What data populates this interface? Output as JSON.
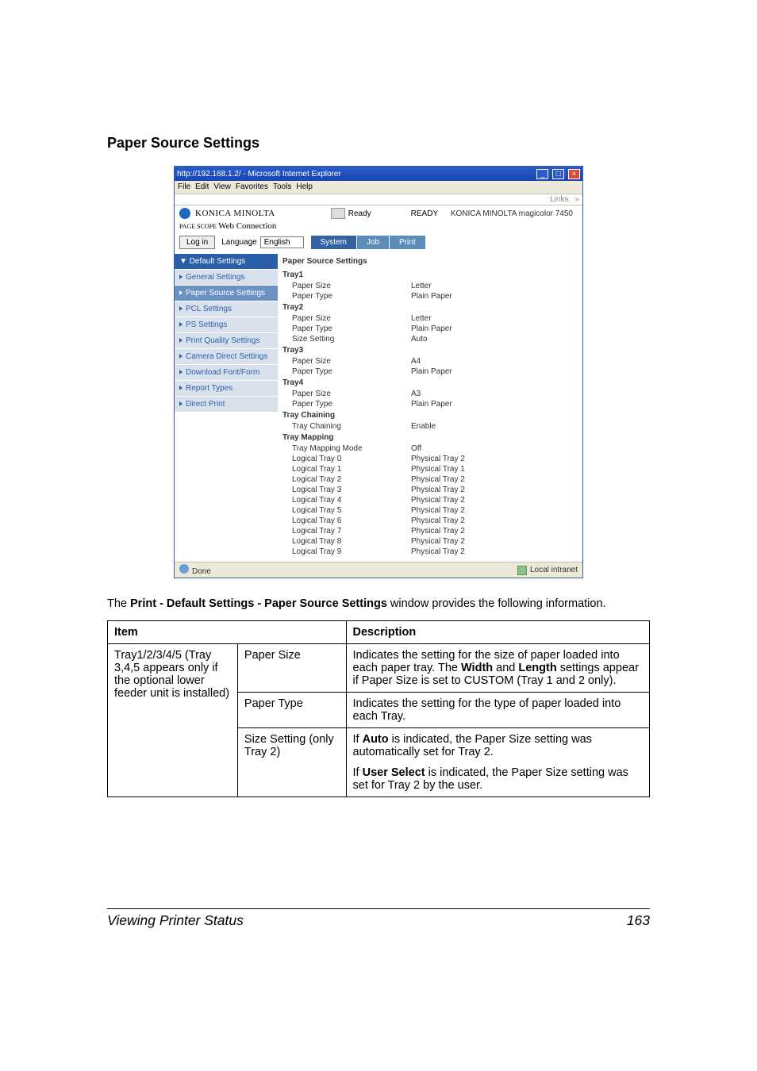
{
  "section_title": "Paper Source Settings",
  "shot": {
    "title_bar": "http://192.168.1.2/ - Microsoft Internet Explorer",
    "menus": [
      "File",
      "Edit",
      "View",
      "Favorites",
      "Tools",
      "Help"
    ],
    "links_label": "Links",
    "brand": "KONICA MINOLTA",
    "status_label": "Ready",
    "status_main": "READY",
    "model": "KONICA MINOLTA magicolor 7450",
    "psws": "Web Connection",
    "psws_sup": "PAGE SCOPE",
    "login": "Log in",
    "lang_label": "Language",
    "lang_value": "English",
    "tabs": {
      "system": "System",
      "job": "Job",
      "print": "Print"
    },
    "side_header": "Default Settings",
    "side_items": [
      "General Settings",
      "Paper Source Settings",
      "PCL Settings",
      "PS Settings",
      "Print Quality Settings",
      "Camera Direct Settings",
      "Download Font/Form",
      "Report Types",
      "Direct Print"
    ],
    "content_heading": "Paper Source Settings",
    "trays": [
      {
        "name": "Tray1",
        "rows": [
          [
            "Paper Size",
            "Letter"
          ],
          [
            "Paper Type",
            "Plain Paper"
          ]
        ]
      },
      {
        "name": "Tray2",
        "rows": [
          [
            "Paper Size",
            "Letter"
          ],
          [
            "Paper Type",
            "Plain Paper"
          ],
          [
            "Size Setting",
            "Auto"
          ]
        ]
      },
      {
        "name": "Tray3",
        "rows": [
          [
            "Paper Size",
            "A4"
          ],
          [
            "Paper Type",
            "Plain Paper"
          ]
        ]
      },
      {
        "name": "Tray4",
        "rows": [
          [
            "Paper Size",
            "A3"
          ],
          [
            "Paper Type",
            "Plain Paper"
          ]
        ]
      }
    ],
    "chain_hdr": "Tray Chaining",
    "chain_rows": [
      [
        "Tray Chaining",
        "Enable"
      ]
    ],
    "map_hdr": "Tray Mapping",
    "map_rows": [
      [
        "Tray Mapping Mode",
        "Off"
      ],
      [
        "Logical Tray 0",
        "Physical Tray 2"
      ],
      [
        "Logical Tray 1",
        "Physical Tray 1"
      ],
      [
        "Logical Tray 2",
        "Physical Tray 2"
      ],
      [
        "Logical Tray 3",
        "Physical Tray 2"
      ],
      [
        "Logical Tray 4",
        "Physical Tray 2"
      ],
      [
        "Logical Tray 5",
        "Physical Tray 2"
      ],
      [
        "Logical Tray 6",
        "Physical Tray 2"
      ],
      [
        "Logical Tray 7",
        "Physical Tray 2"
      ],
      [
        "Logical Tray 8",
        "Physical Tray 2"
      ],
      [
        "Logical Tray 9",
        "Physical Tray 2"
      ]
    ],
    "done": "Done",
    "intranet": "Local intranet"
  },
  "intro_pre": "The ",
  "intro_bold": "Print - Default Settings - Paper Source Settings",
  "intro_post": " window provides the following information.",
  "table": {
    "h_item": "Item",
    "h_desc": "Description",
    "r1c1": "Tray1/2/3/4/5 (Tray 3,4,5 appears only if the optional lower feeder unit is installed)",
    "r1c2": "Paper Size",
    "r1c3_a": "Indicates the setting for the size of paper loaded into each paper tray. The ",
    "r1c3_b": "Width",
    "r1c3_c": " and ",
    "r1c3_d": "Length",
    "r1c3_e": " settings appear if Paper Size is set to CUSTOM (Tray 1 and 2 only).",
    "r2c2": "Paper Type",
    "r2c3": "Indicates the setting for the type of paper loaded into each Tray.",
    "r3c2": "Size Setting (only Tray 2)",
    "r3c3_a": "If ",
    "r3c3_b": "Auto",
    "r3c3_c": " is indicated, the Paper Size setting was automatically set for Tray 2.",
    "r3c3_d": "If ",
    "r3c3_e": "User Select",
    "r3c3_f": " is indicated, the Paper Size setting was set for Tray 2 by the user."
  },
  "footer": {
    "title": "Viewing Printer Status",
    "page": "163"
  }
}
